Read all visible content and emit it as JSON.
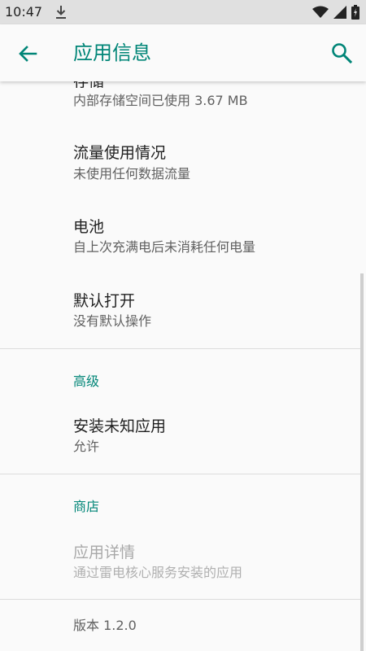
{
  "status": {
    "time": "10:47"
  },
  "appbar": {
    "title": "应用信息"
  },
  "items": [
    {
      "title": "存储",
      "subtitle": "内部存储空间已使用 3.67 MB"
    },
    {
      "title": "流量使用情况",
      "subtitle": "未使用任何数据流量"
    },
    {
      "title": "电池",
      "subtitle": "自上次充满电后未消耗任何电量"
    },
    {
      "title": "默认打开",
      "subtitle": "没有默认操作"
    }
  ],
  "advanced": {
    "header": "高级",
    "items": [
      {
        "title": "安装未知应用",
        "subtitle": "允许"
      }
    ]
  },
  "store": {
    "header": "商店",
    "items": [
      {
        "title": "应用详情",
        "subtitle": "通过雷电核心服务安装的应用"
      }
    ]
  },
  "version": "版本 1.2.0",
  "colors": {
    "accent": "#008577",
    "statusbar": "#e0e0e0",
    "background": "#fafafa"
  }
}
